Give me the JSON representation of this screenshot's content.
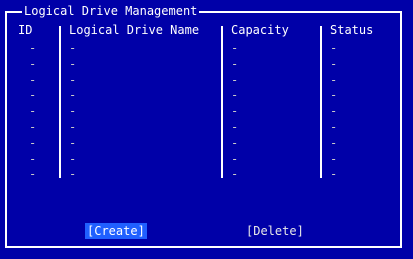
{
  "panel": {
    "title": "Logical Drive Management"
  },
  "columns": {
    "id": "ID",
    "name": "Logical Drive Name",
    "capacity": "Capacity",
    "status": "Status"
  },
  "rows": [
    {
      "id": "-",
      "name": "-",
      "capacity": "-",
      "status": "-"
    },
    {
      "id": "-",
      "name": "-",
      "capacity": "-",
      "status": "-"
    },
    {
      "id": "-",
      "name": "-",
      "capacity": "-",
      "status": "-"
    },
    {
      "id": "-",
      "name": "-",
      "capacity": "-",
      "status": "-"
    },
    {
      "id": "-",
      "name": "-",
      "capacity": "-",
      "status": "-"
    },
    {
      "id": "-",
      "name": "-",
      "capacity": "-",
      "status": "-"
    },
    {
      "id": "-",
      "name": "-",
      "capacity": "-",
      "status": "-"
    },
    {
      "id": "-",
      "name": "-",
      "capacity": "-",
      "status": "-"
    },
    {
      "id": "-",
      "name": "-",
      "capacity": "-",
      "status": "-"
    }
  ],
  "buttons": {
    "create": "[Create]",
    "delete": "[Delete]"
  },
  "colors": {
    "background": "#0000a8",
    "foreground": "#ffffff",
    "selected": "#2060ff"
  }
}
